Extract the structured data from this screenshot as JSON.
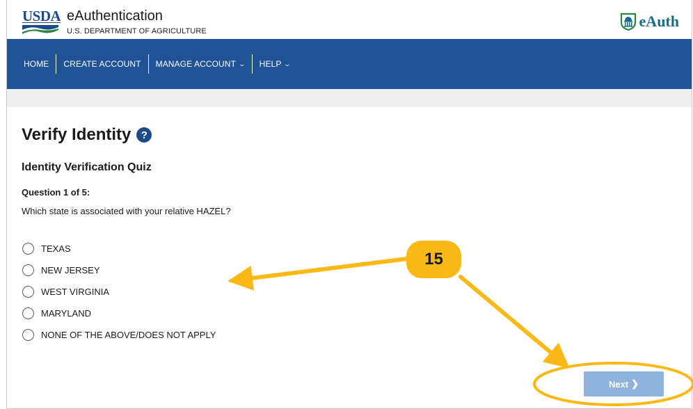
{
  "header": {
    "usda_label": "USDA",
    "app_title": "eAuthentication",
    "department": "U.S. DEPARTMENT OF AGRICULTURE",
    "eauth_logo_text": "eAuth"
  },
  "nav": {
    "items": [
      {
        "label": "HOME",
        "has_dropdown": false
      },
      {
        "label": "CREATE ACCOUNT",
        "has_dropdown": false
      },
      {
        "label": "MANAGE ACCOUNT",
        "has_dropdown": true
      },
      {
        "label": "HELP",
        "has_dropdown": true
      }
    ]
  },
  "page": {
    "title": "Verify Identity",
    "help_icon": "?",
    "quiz_title": "Identity Verification Quiz",
    "question_number": "Question 1 of 5:",
    "question_text": "Which state is associated with your relative HAZEL?",
    "options": [
      "TEXAS",
      "NEW JERSEY",
      "WEST VIRGINIA",
      "MARYLAND",
      "NONE OF THE ABOVE/DOES NOT APPLY"
    ],
    "next_label": "Next"
  },
  "annotation": {
    "step_number": "15",
    "color": "#fbb917"
  },
  "colors": {
    "nav_bg": "#1f5396",
    "brand_blue": "#1f4a8a",
    "next_disabled": "#8fb3dd"
  }
}
